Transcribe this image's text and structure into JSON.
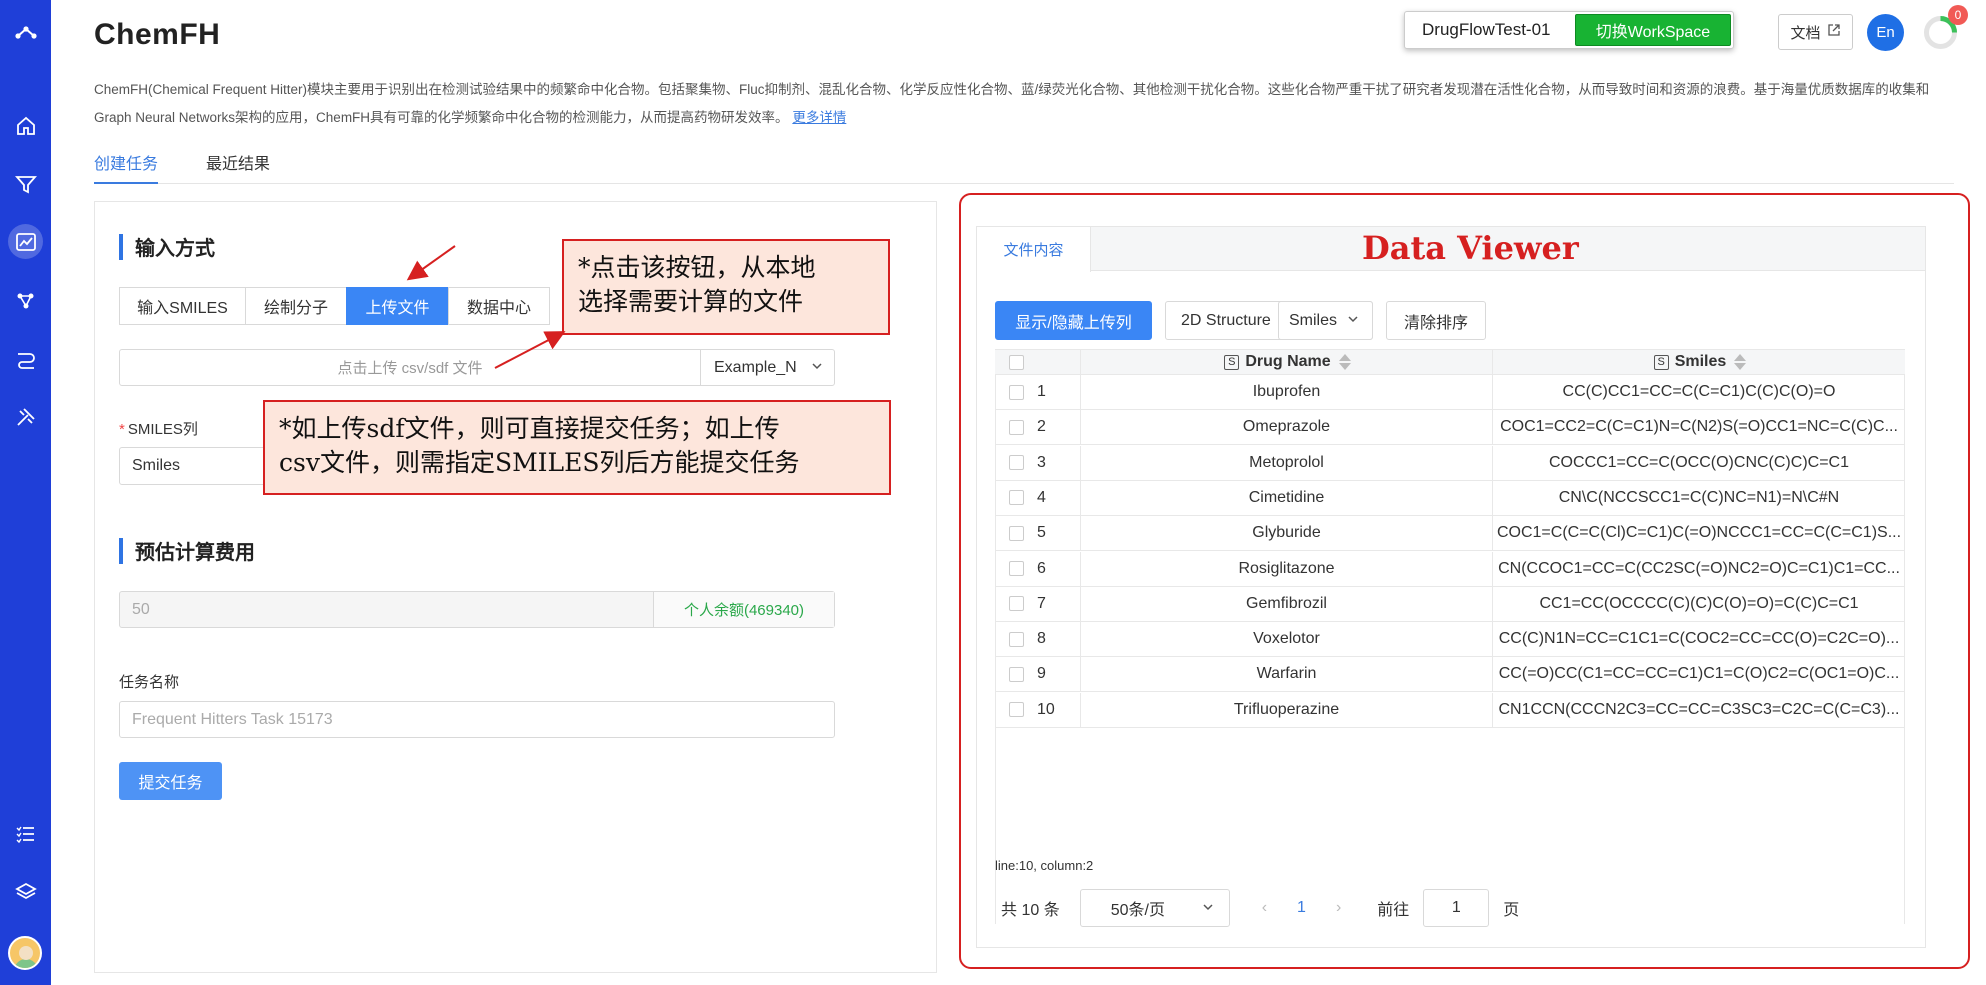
{
  "app": {
    "title": "ChemFH",
    "workspace_name": "DrugFlowTest-01",
    "switch_workspace": "切换WorkSpace",
    "docs_label": "文档",
    "lang_label": "En",
    "notification_count": "0",
    "description": "ChemFH(Chemical Frequent Hitter)模块主要用于识别出在检测试验结果中的频繁命中化合物。包括聚集物、Fluc抑制剂、混乱化合物、化学反应性化合物、蓝/绿荧光化合物、其他检测干扰化合物。这些化合物严重干扰了研究者发现潜在活性化合物，从而导致时间和资源的浪费。基于海量优质数据库的收集和Graph Neural Networks架构的应用，ChemFH具有可靠的化学频繁命中化合物的检测能力，从而提高药物研发效率。",
    "more_link": "更多详情"
  },
  "tabs": [
    {
      "label": "创建任务",
      "active": true
    },
    {
      "label": "最近结果",
      "active": false
    }
  ],
  "left": {
    "input_title": "输入方式",
    "modes": [
      {
        "label": "输入SMILES",
        "active": false
      },
      {
        "label": "绘制分子",
        "active": false
      },
      {
        "label": "上传文件",
        "active": true
      },
      {
        "label": "数据中心",
        "active": false
      }
    ],
    "upload_placeholder": "点击上传 csv/sdf 文件",
    "example_select": "Example_N",
    "smiles_col_label": "SMILES列",
    "smiles_col_value": "Smiles",
    "cost_title": "预估计算费用",
    "cost_value": "50",
    "balance": "个人余额(469340)",
    "task_name_label": "任务名称",
    "task_name_placeholder": "Frequent Hitters Task 15173",
    "submit": "提交任务"
  },
  "callouts": {
    "upload_line1": "*点击该按钮，从本地",
    "upload_line2": "选择需要计算的文件",
    "sdf_line1": "*如上传sdf文件，则可直接提交任务；如上传",
    "sdf_line2": "csv文件，则需指定SMILES列后方能提交任务"
  },
  "viewer": {
    "tab_label": "文件内容",
    "title": "Data Viewer",
    "toggle_btn": "显示/隐藏上传列",
    "structure_label": "2D Structure",
    "structure_select": "Smiles",
    "clear_sort": "清除排序",
    "col_name": "Drug Name",
    "col_smiles": "Smiles",
    "col_icon": "S",
    "rows": [
      {
        "idx": "1",
        "name": "Ibuprofen",
        "smiles": "CC(C)CC1=CC=C(C=C1)C(C)C(O)=O"
      },
      {
        "idx": "2",
        "name": "Omeprazole",
        "smiles": "COC1=CC2=C(C=C1)N=C(N2)S(=O)CC1=NC=C(C)C..."
      },
      {
        "idx": "3",
        "name": "Metoprolol",
        "smiles": "COCCC1=CC=C(OCC(O)CNC(C)C)C=C1"
      },
      {
        "idx": "4",
        "name": "Cimetidine",
        "smiles": "CN\\C(NCCSCC1=C(C)NC=N1)=N\\C#N"
      },
      {
        "idx": "5",
        "name": "Glyburide",
        "smiles": "COC1=C(C=C(Cl)C=C1)C(=O)NCCC1=CC=C(C=C1)S..."
      },
      {
        "idx": "6",
        "name": "Rosiglitazone",
        "smiles": "CN(CCOC1=CC=C(CC2SC(=O)NC2=O)C=C1)C1=CC..."
      },
      {
        "idx": "7",
        "name": "Gemfibrozil",
        "smiles": "CC1=CC(OCCCC(C)(C)C(O)=O)=C(C)C=C1"
      },
      {
        "idx": "8",
        "name": "Voxelotor",
        "smiles": "CC(C)N1N=CC=C1C1=C(COC2=CC=CC(O)=C2C=O)..."
      },
      {
        "idx": "9",
        "name": "Warfarin",
        "smiles": "CC(=O)CC(C1=CC=CC=C1)C1=C(O)C2=C(OC1=O)C..."
      },
      {
        "idx": "10",
        "name": "Trifluoperazine",
        "smiles": "CN1CCN(CCCN2C3=CC=CC=C3SC3=C2C=C(C=C3)..."
      }
    ],
    "status": "line:10, column:2",
    "total": "共 10 条",
    "page_size": "50条/页",
    "prev": "‹",
    "current_page": "1",
    "next": "›",
    "goto_label": "前往",
    "goto_value": "1",
    "page_suffix": "页"
  },
  "colors": {
    "sidebar": "#1f3fd8",
    "accent": "#3a86f5",
    "annotation_red": "#d62020",
    "balance_green": "#2aa84a"
  }
}
